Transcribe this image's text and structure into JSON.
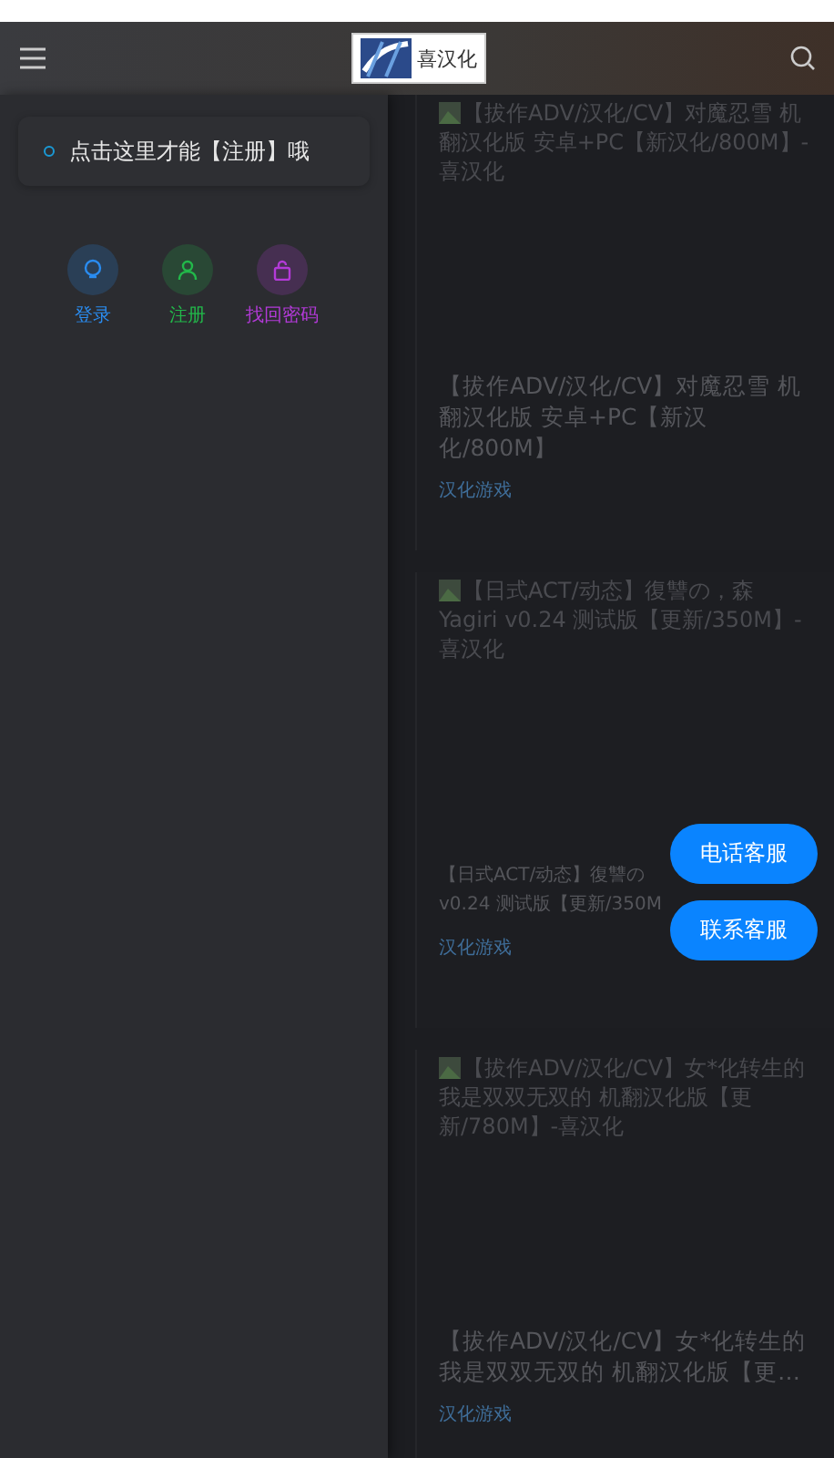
{
  "header": {
    "logo_text": "喜汉化"
  },
  "drawer": {
    "notice": "点击这里才能【注册】哦",
    "actions": [
      {
        "kind": "login",
        "label": "登录",
        "color": "#2a8cf0"
      },
      {
        "kind": "register",
        "label": "注册",
        "color": "#22b84a"
      },
      {
        "kind": "recover",
        "label": "找回密码",
        "color": "#b33ad8"
      }
    ]
  },
  "posts": [
    {
      "image_alt": "【拔作ADV/汉化/CV】对魔忍雪 机翻汉化版 安卓+PC【新汉化/800M】-喜汉化",
      "title": "【拔作ADV/汉化/CV】对魔忍雪 机翻汉化版 安卓+PC【新汉化/800M】",
      "tag": "汉化游戏"
    },
    {
      "image_alt": "【日式ACT/动态】復讐の，森 Yagiri v0.24 测试版【更新/350M】-喜汉化",
      "title": "【日式ACT/动态】復讐の v0.24 测试版【更新/350M",
      "tag": "汉化游戏"
    },
    {
      "image_alt": "【拔作ADV/汉化/CV】女*化转生的我是双双无双的 机翻汉化版【更新/780M】-喜汉化",
      "title": "【拔作ADV/汉化/CV】女*化转生的我是双双无双的 机翻汉化版【更…",
      "tag": "汉化游戏"
    }
  ],
  "float_buttons": [
    "电话客服",
    "联系客服"
  ]
}
